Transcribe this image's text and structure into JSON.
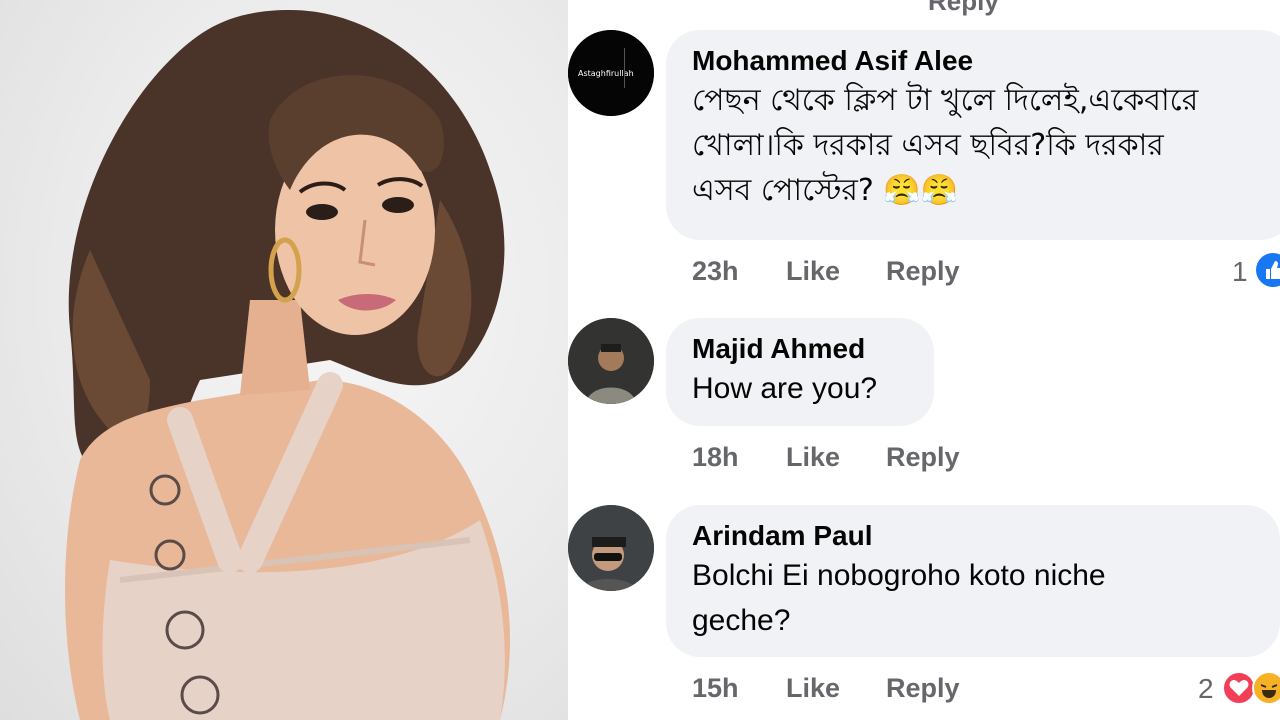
{
  "top_cut_text": "Reply",
  "comments": [
    {
      "author": "Mohammed Asif Alee",
      "avatar_icon": "avatar-icon",
      "avatar_text": "Astaghfirullah",
      "text_lines": [
        "পেছন থেকে ক্লিপ টা খুলে দিলেই,একেবারে",
        "খোলা।কি দরকার এসব ছবির?কি দরকার",
        "এসব পোস্টের? 😤😤"
      ],
      "time": "23h",
      "like_label": "Like",
      "reply_label": "Reply",
      "reaction_count": "1",
      "reactions": [
        "like-reaction-icon"
      ]
    },
    {
      "author": "Majid Ahmed",
      "avatar_icon": "avatar-icon",
      "text_lines": [
        "How are you?"
      ],
      "time": "18h",
      "like_label": "Like",
      "reply_label": "Reply"
    },
    {
      "author": "Arindam Paul",
      "avatar_icon": "avatar-icon",
      "text_lines": [
        "Bolchi Ei nobogroho koto niche",
        "geche?"
      ],
      "time": "15h",
      "like_label": "Like",
      "reply_label": "Reply",
      "reaction_count": "2",
      "reactions": [
        "love-reaction-icon",
        "haha-reaction-icon"
      ]
    }
  ],
  "colors": {
    "bubble": "#f0f2f5",
    "text": "#050505",
    "meta": "#65676b",
    "like_blue": "#1877f2",
    "love_red": "#f33e58",
    "haha_yellow": "#f7b125"
  }
}
